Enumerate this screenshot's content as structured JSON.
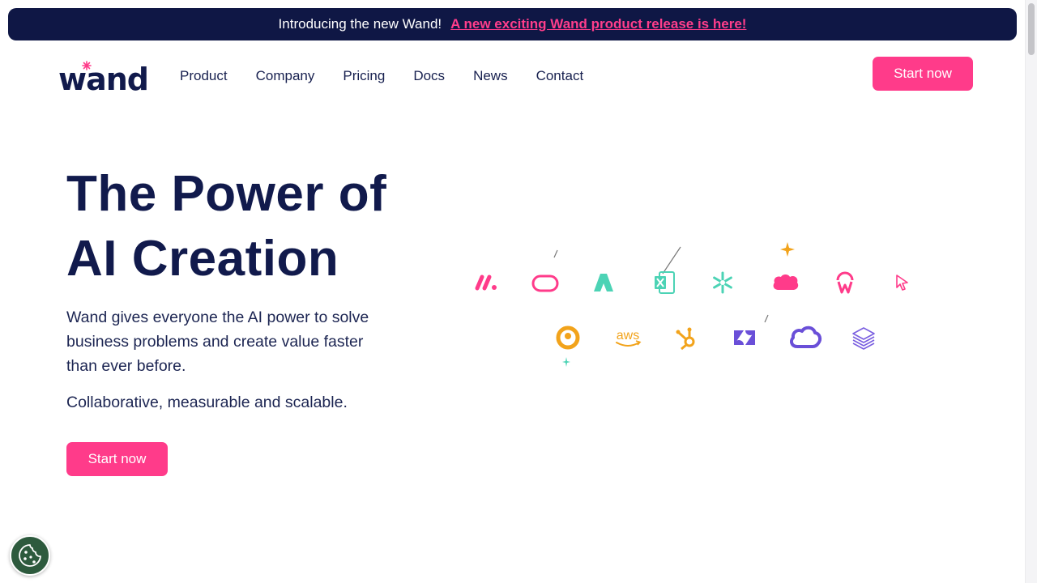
{
  "announcement": {
    "text": "Introducing the new Wand!",
    "link": "A new exciting Wand product release is here!"
  },
  "brand": {
    "logo_text": "wand",
    "accent": "#ff3b8a",
    "navy": "#0f1745"
  },
  "nav": {
    "items": [
      "Product",
      "Company",
      "Pricing",
      "Docs",
      "News",
      "Contact"
    ],
    "cta": "Start now"
  },
  "hero": {
    "title_line1": "The Power of",
    "title_line2": "AI Creation",
    "description": "Wand gives everyone the AI power to solve business problems and create value faster than ever before.",
    "tagline": "Collaborative, measurable and scalable.",
    "cta": "Start now"
  },
  "integrations": {
    "row1": [
      "monday-icon",
      "oracle-icon",
      "azure-icon",
      "excel-icon",
      "snowflake-icon",
      "salesforce-icon",
      "workato-icon",
      "cursor-icon"
    ],
    "row2": [
      "looker-icon",
      "aws-icon",
      "hubspot-icon",
      "zendesk-icon",
      "google-cloud-icon",
      "stack-icon"
    ],
    "aws_label": "aws"
  },
  "cookie": {
    "icon": "cookie-icon"
  }
}
